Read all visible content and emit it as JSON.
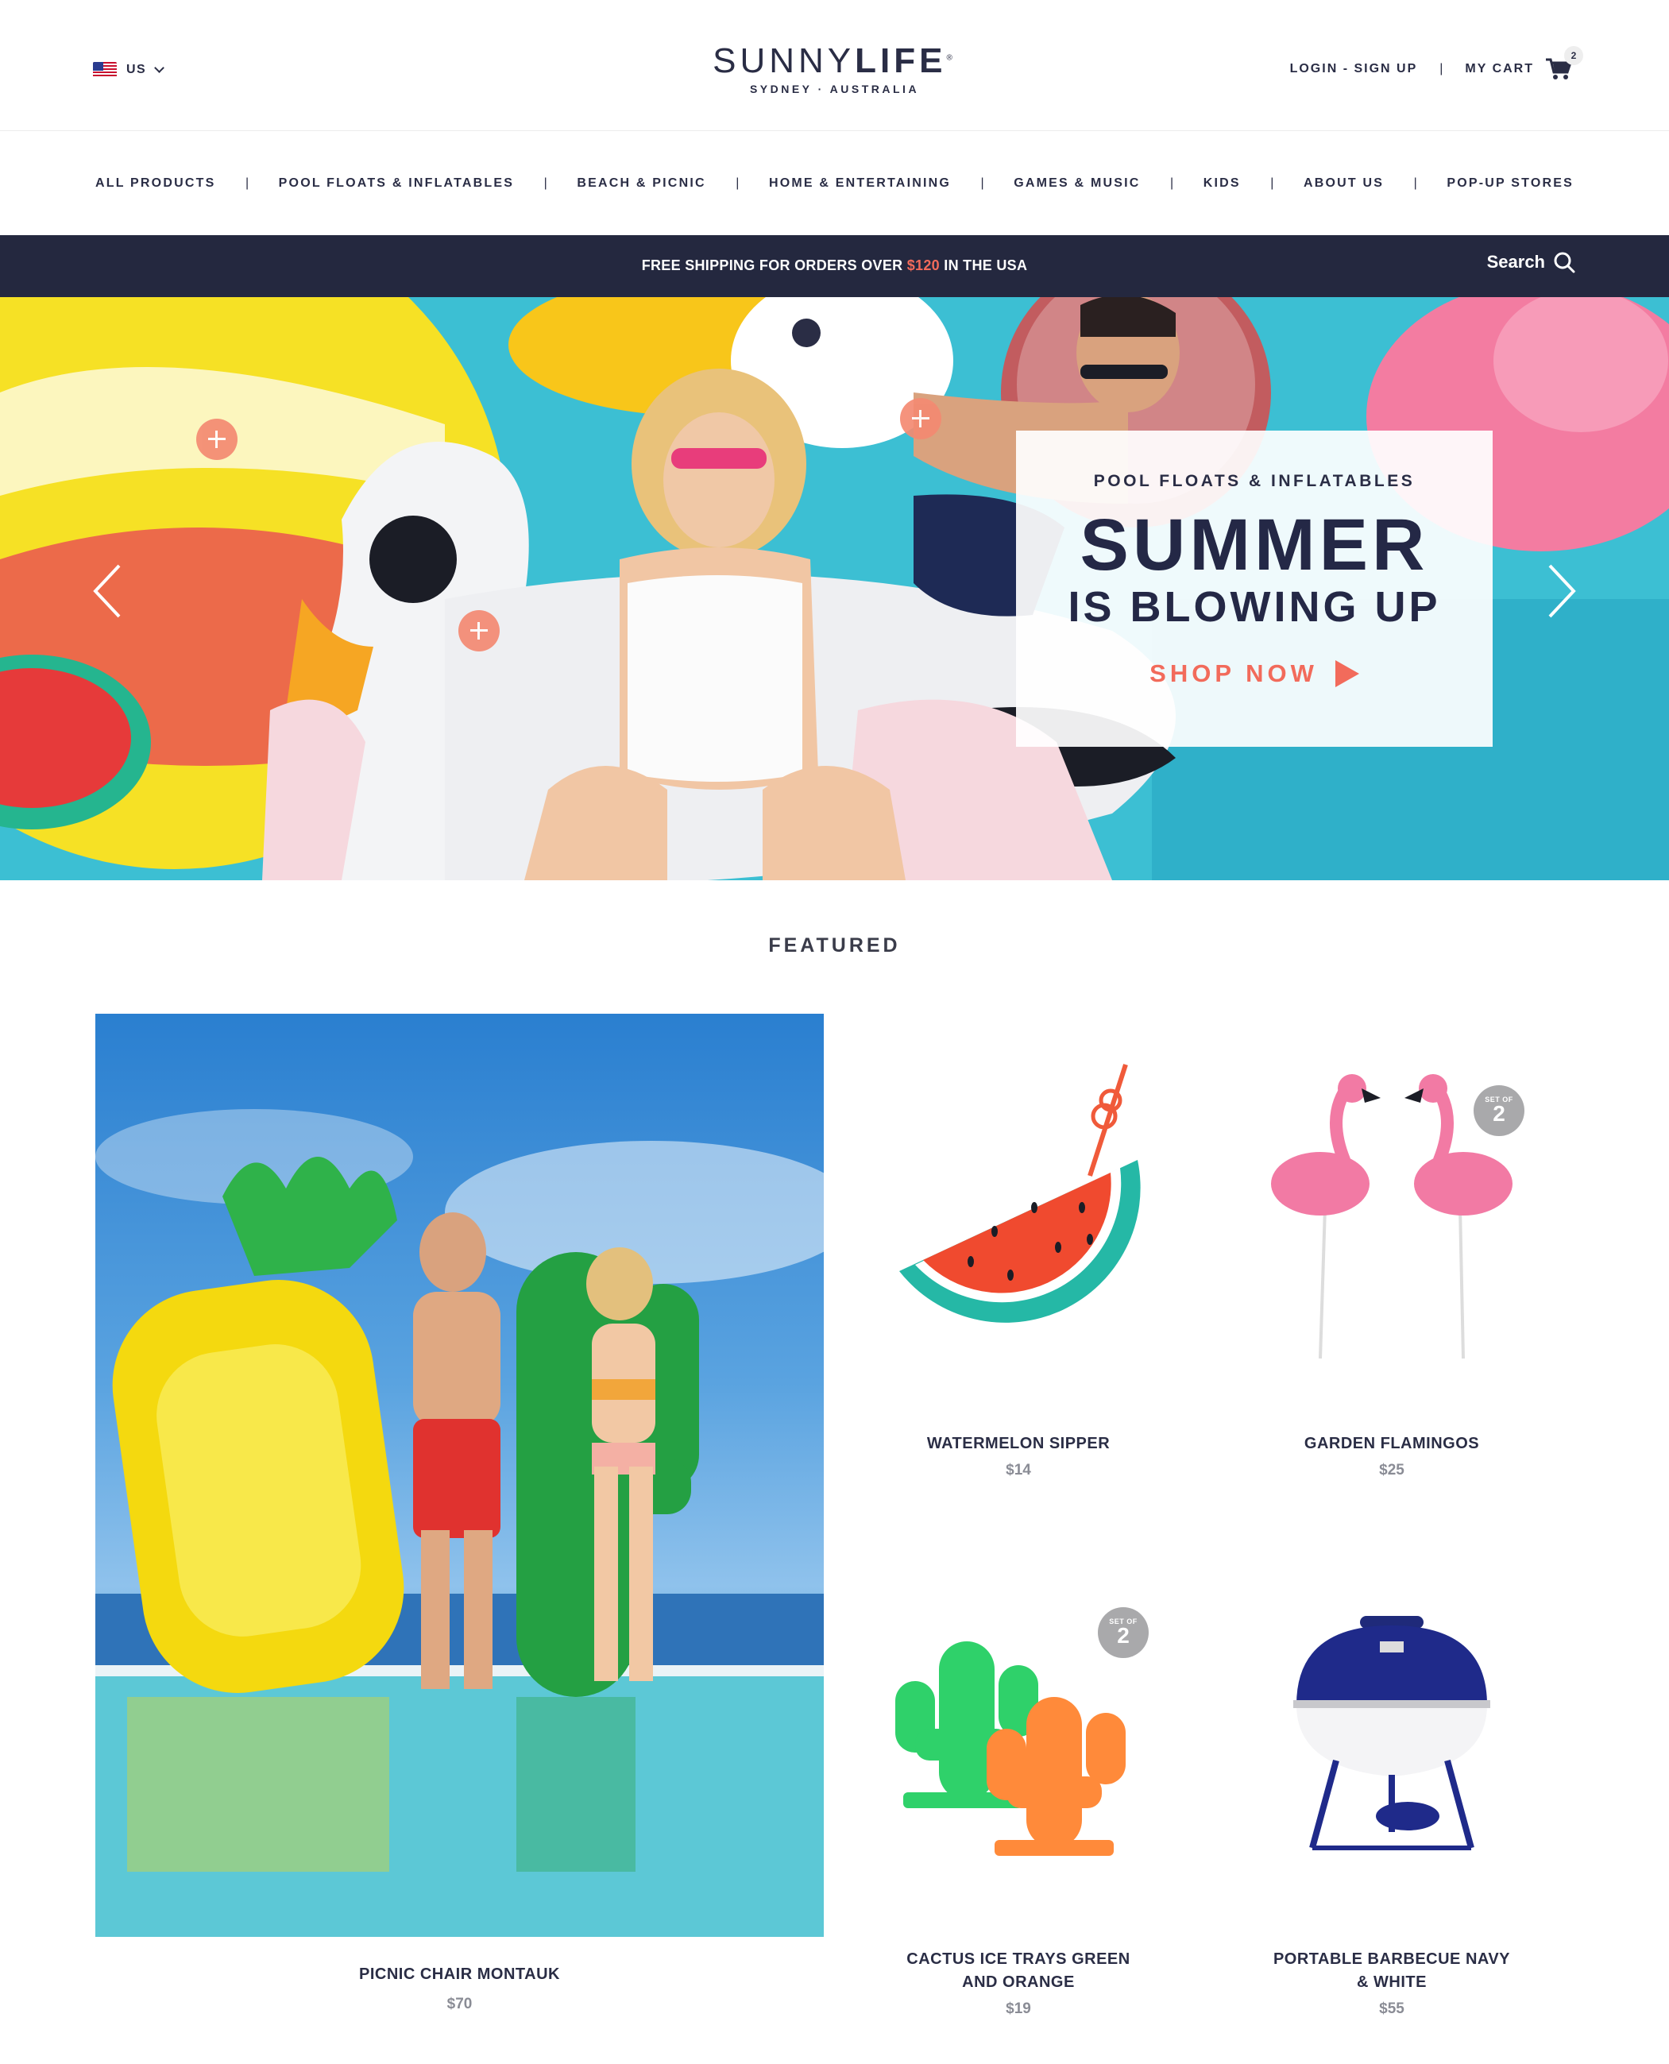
{
  "header": {
    "locale": "US",
    "logo_main_light": "SUNNY",
    "logo_main_bold": "LIFE",
    "logo_reg": "®",
    "logo_sub": "SYDNEY · AUSTRALIA",
    "login_label": "LOGIN - SIGN UP",
    "separator": "|",
    "cart_label": "MY CART",
    "cart_count": "2"
  },
  "nav": {
    "items": [
      {
        "label": "ALL PRODUCTS"
      },
      {
        "label": "POOL FLOATS & INFLATABLES"
      },
      {
        "label": "BEACH & PICNIC"
      },
      {
        "label": "HOME & ENTERTAINING"
      },
      {
        "label": "GAMES & MUSIC"
      },
      {
        "label": "KIDS"
      },
      {
        "label": "ABOUT US"
      },
      {
        "label": "POP-UP STORES"
      }
    ],
    "separator": "|"
  },
  "promo": {
    "text_before": "FREE SHIPPING FOR ORDERS OVER ",
    "amount": "$120",
    "text_after": " IN THE USA",
    "search_label": "Search"
  },
  "hero": {
    "eyebrow": "POOL FLOATS & INFLATABLES",
    "title": "SUMMER",
    "subtitle": "IS BLOWING UP",
    "cta": "SHOP NOW",
    "accent": "#f26b5b"
  },
  "featured": {
    "title": "FEATURED",
    "main": {
      "name": "PICNIC CHAIR MONTAUK",
      "price": "$70"
    },
    "products": [
      {
        "name": "WATERMELON SIPPER",
        "price": "$14"
      },
      {
        "name": "GARDEN FLAMINGOS",
        "price": "$25",
        "badge_top": "SET OF",
        "badge_num": "2"
      },
      {
        "name_line1": "CACTUS ICE TRAYS GREEN",
        "name_line2": "AND ORANGE",
        "price": "$19",
        "badge_top": "SET OF",
        "badge_num": "2"
      },
      {
        "name_line1": "PORTABLE BARBECUE NAVY",
        "name_line2": "& WHITE",
        "price": "$55"
      }
    ]
  },
  "colors": {
    "navy": "#24283f",
    "coral": "#f26b5b",
    "grey_text": "#8a8c95"
  }
}
